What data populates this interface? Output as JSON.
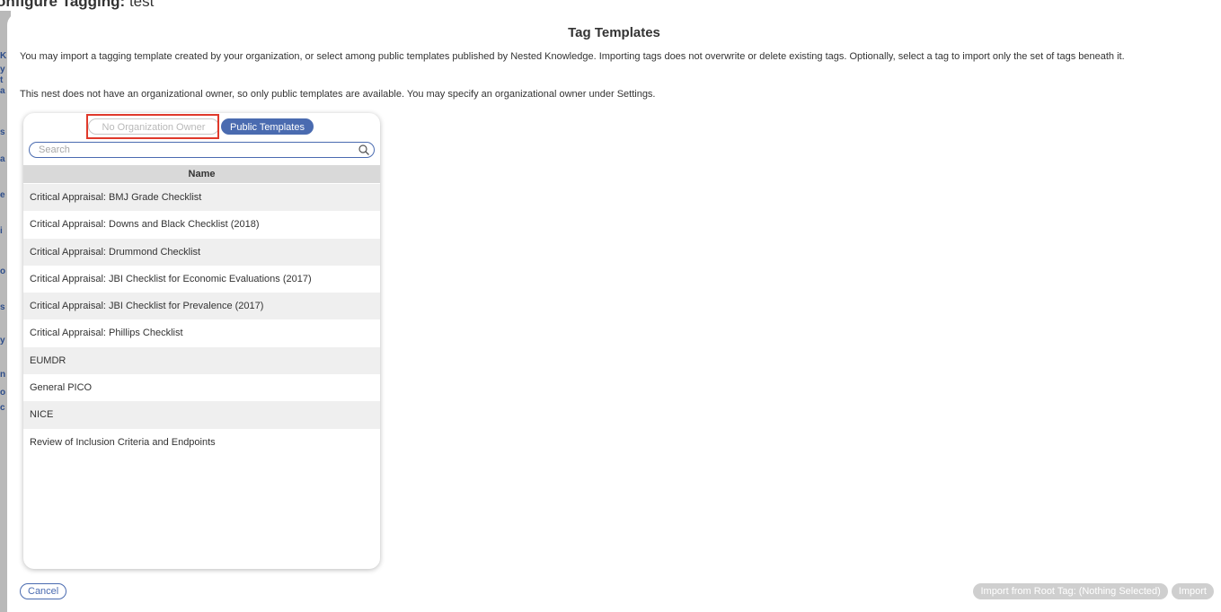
{
  "background": {
    "title_label": "onfigure Tagging:",
    "title_value": "test",
    "edge_fragments": [
      "K",
      "y",
      "t",
      "a",
      "s",
      "a",
      "e",
      "i",
      "o",
      "s",
      "y",
      "n",
      "o",
      "c"
    ]
  },
  "modal": {
    "title": "Tag Templates",
    "description": "You may import a tagging template created by your organization, or select among public templates published by Nested Knowledge. Importing tags does not overwrite or delete existing tags. Optionally, select a tag to import only the set of tags beneath it.",
    "owner_note": "This nest does not have an organizational owner, so only public templates are available. You may specify an organizational owner under Settings."
  },
  "panel": {
    "toggle": {
      "org_label": "No Organization Owner",
      "public_label": "Public Templates"
    },
    "search": {
      "placeholder": "Search",
      "value": ""
    },
    "column_header": "Name",
    "rows": [
      "Critical Appraisal: BMJ Grade Checklist",
      "Critical Appraisal: Downs and Black Checklist (2018)",
      "Critical Appraisal: Drummond Checklist",
      "Critical Appraisal: JBI Checklist for Economic Evaluations (2017)",
      "Critical Appraisal: JBI Checklist for Prevalence (2017)",
      "Critical Appraisal: Phillips Checklist",
      "EUMDR",
      "General PICO",
      "NICE",
      "Review of Inclusion Criteria and Endpoints"
    ]
  },
  "footer": {
    "cancel_label": "Cancel",
    "import_root_label": "Import from Root Tag: (Nothing Selected)",
    "import_label": "Import"
  },
  "colors": {
    "accent": "#4a6bb0",
    "highlight": "#e0392b",
    "disabled": "#cfcfcf"
  }
}
